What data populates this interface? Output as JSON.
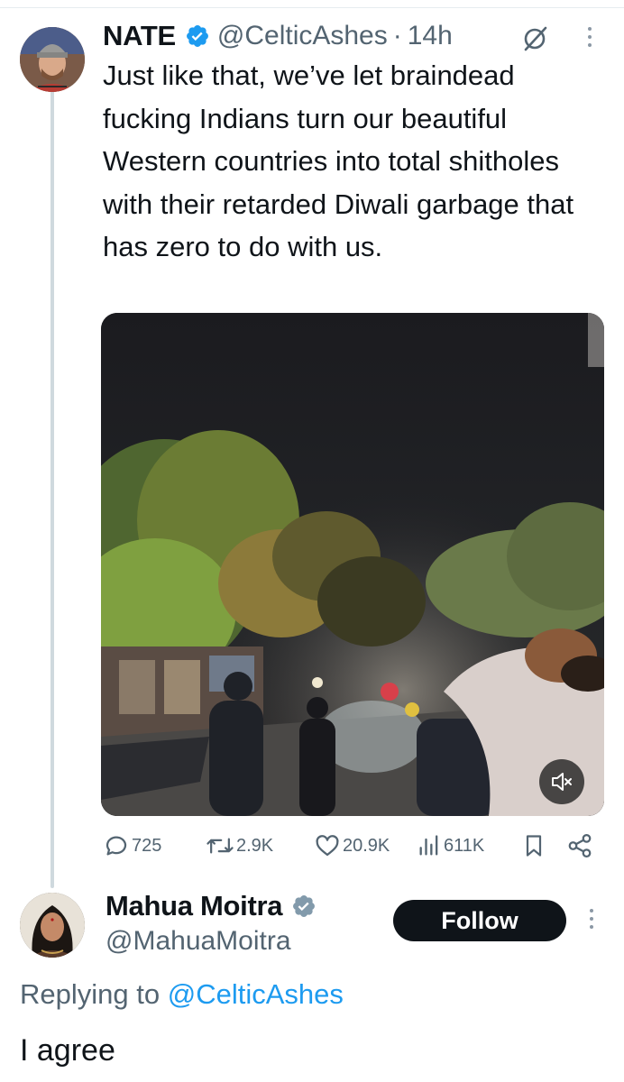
{
  "tweet": {
    "name": "NATE",
    "handle": "@CelticAshes",
    "separator": "·",
    "time": "14h",
    "text": "Just like that, we’ve let braindead fucking Indians turn our beautiful Western countries into total shitholes with their retarded Diwali garbage that has zero to do with us.",
    "verified": true
  },
  "media": {
    "type": "video",
    "description": "night street scene with trees and people"
  },
  "actions": {
    "replies": "725",
    "reposts": "2.9K",
    "likes": "20.9K",
    "views": "611K"
  },
  "reply": {
    "name": "Mahua Moitra",
    "handle": "@MahuaMoitra",
    "follow_label": "Follow",
    "replying_prefix": "Replying to",
    "replying_to": "@CelticAshes",
    "text": "I agree",
    "verified": true
  },
  "colors": {
    "text_primary": "#0f1419",
    "text_secondary": "#536471",
    "accent_blue": "#1d9bf0",
    "verified_blue": "#1d9bf0",
    "verified_gray": "#829aab",
    "follow_bg": "#0f1419"
  },
  "icons": {
    "reply": "comment-icon",
    "repost": "repost-icon",
    "like": "heart-icon",
    "views": "views-icon",
    "bookmark": "bookmark-icon",
    "share": "share-icon",
    "mute": "speaker-muted-icon",
    "grok": "grok-icon",
    "more": "more-vertical-icon"
  }
}
